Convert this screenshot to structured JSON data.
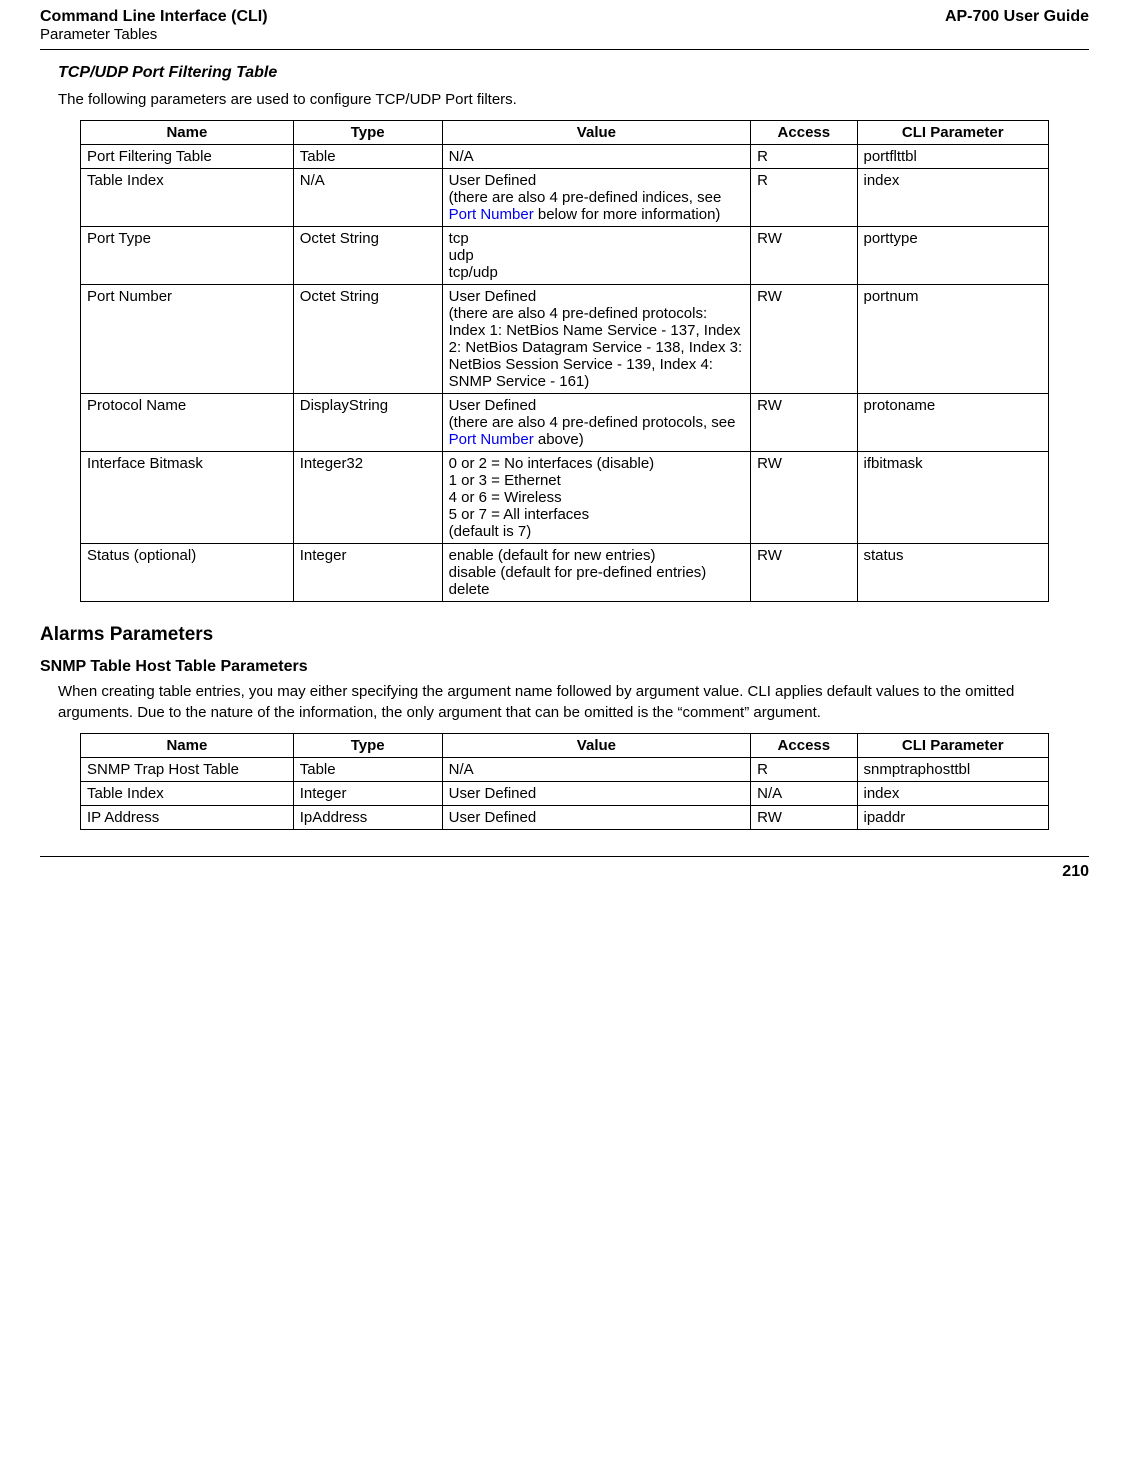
{
  "header": {
    "left_line1": "Command Line Interface (CLI)",
    "left_line2": "Parameter Tables",
    "right": "AP-700 User Guide"
  },
  "section1": {
    "heading": "TCP/UDP Port Filtering Table",
    "intro": "The following parameters are used to configure TCP/UDP Port filters."
  },
  "table1": {
    "headers": [
      "Name",
      "Type",
      "Value",
      "Access",
      "CLI Parameter"
    ],
    "rows": [
      {
        "name": "Port Filtering Table",
        "type": "Table",
        "value_parts": [
          "N/A"
        ],
        "access": "R",
        "cli": "portflttbl"
      },
      {
        "name": "Table Index",
        "type": "N/A",
        "value_parts_pre": "User Defined\n(there are also 4 pre-defined indices, see ",
        "value_link": "Port Number",
        "value_parts_post": " below for more information)",
        "access": "R",
        "cli": "index"
      },
      {
        "name": "Port Type",
        "type": "Octet String",
        "value_parts": [
          "tcp\nudp\ntcp/udp"
        ],
        "access": "RW",
        "cli": "porttype"
      },
      {
        "name": "Port Number",
        "type": "Octet String",
        "value_parts": [
          "User Defined\n(there are also 4 pre-defined protocols: Index 1: NetBios Name Service - 137, Index 2: NetBios Datagram Service - 138, Index 3: NetBios Session Service - 139, Index 4: SNMP Service - 161)"
        ],
        "access": "RW",
        "cli": "portnum"
      },
      {
        "name": "Protocol Name",
        "type": "DisplayString",
        "value_parts_pre": "User Defined\n(there are also 4 pre-defined protocols, see ",
        "value_link": "Port Number",
        "value_parts_post": " above)",
        "access": "RW",
        "cli": "protoname"
      },
      {
        "name": "Interface Bitmask",
        "type": "Integer32",
        "value_parts": [
          "0 or 2 = No interfaces (disable)\n1 or 3 = Ethernet\n4 or 6 = Wireless\n5 or 7 = All interfaces\n(default is 7)"
        ],
        "access": "RW",
        "cli": "ifbitmask"
      },
      {
        "name": "Status (optional)",
        "type": "Integer",
        "value_parts": [
          "enable (default for new entries)\ndisable (default for pre-defined entries)\ndelete"
        ],
        "access": "RW",
        "cli": "status"
      }
    ]
  },
  "section2": {
    "h2": "Alarms Parameters",
    "h3": "SNMP Table Host Table Parameters",
    "intro": "When creating table entries, you may either specifying the argument name followed by argument value. CLI applies default values to the omitted arguments. Due to the nature of the information, the only argument that can be omitted is the “comment” argument."
  },
  "table2": {
    "headers": [
      "Name",
      "Type",
      "Value",
      "Access",
      "CLI Parameter"
    ],
    "rows": [
      {
        "name": "SNMP Trap Host Table",
        "type": "Table",
        "value": "N/A",
        "access": "R",
        "cli": "snmptraphosttbl"
      },
      {
        "name": "Table Index",
        "type": "Integer",
        "value": "User Defined",
        "access": "N/A",
        "cli": "index"
      },
      {
        "name": "IP Address",
        "type": "IpAddress",
        "value": "User Defined",
        "access": "RW",
        "cli": "ipaddr"
      }
    ]
  },
  "footer": {
    "page_number": "210"
  }
}
